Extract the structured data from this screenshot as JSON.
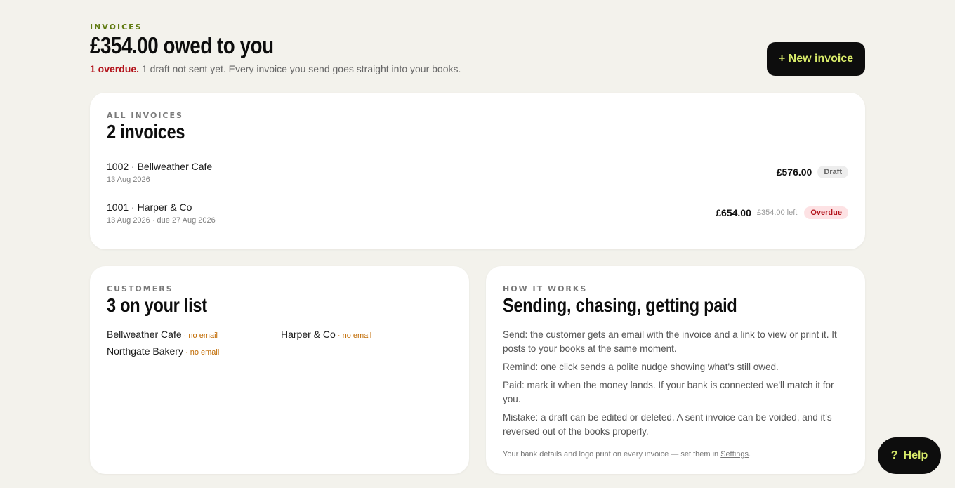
{
  "header": {
    "eyebrow": "INVOICES",
    "title": "£354.00 owed to you",
    "overdue": "1 overdue.",
    "subtitle": " 1 draft not sent yet. Every invoice you send goes straight into your books.",
    "new_button": "+ New invoice"
  },
  "invoices": {
    "eyebrow": "ALL INVOICES",
    "title": "2 invoices",
    "rows": [
      {
        "name": "1002 · Bellweather Cafe",
        "date": "13 Aug 2026",
        "amount": "£576.00",
        "left": "",
        "status": "Draft"
      },
      {
        "name": "1001 · Harper & Co",
        "date": "13 Aug 2026 · due 27 Aug 2026",
        "amount": "£654.00",
        "left": "£354.00 left",
        "status": "Overdue"
      }
    ]
  },
  "customers": {
    "eyebrow": "CUSTOMERS",
    "title": "3 on your list",
    "items": [
      {
        "name": "Bellweather Cafe",
        "note": " · no email"
      },
      {
        "name": "Harper & Co",
        "note": " · no email"
      },
      {
        "name": "Northgate Bakery",
        "note": " · no email"
      }
    ]
  },
  "how_it_works": {
    "eyebrow": "HOW IT WORKS",
    "title": "Sending, chasing, getting paid",
    "steps": [
      "Send: the customer gets an email with the invoice and a link to view or print it. It posts to your books at the same moment.",
      "Remind: one click sends a polite nudge showing what's still owed.",
      "Paid: mark it when the money lands. If your bank is connected we'll match it for you.",
      "Mistake: a draft can be edited or deleted. A sent invoice can be voided, and it's reversed out of the books properly."
    ],
    "note_prefix": "Your bank details and logo print on every invoice — set them in ",
    "note_link": "Settings",
    "note_suffix": "."
  },
  "help": {
    "icon": "?",
    "label": "Help"
  },
  "colors": {
    "accent": "#d9ec6a",
    "overdue": "#b3131b",
    "eyebrow_green": "#5f7a10",
    "background": "#f3f2ec"
  }
}
